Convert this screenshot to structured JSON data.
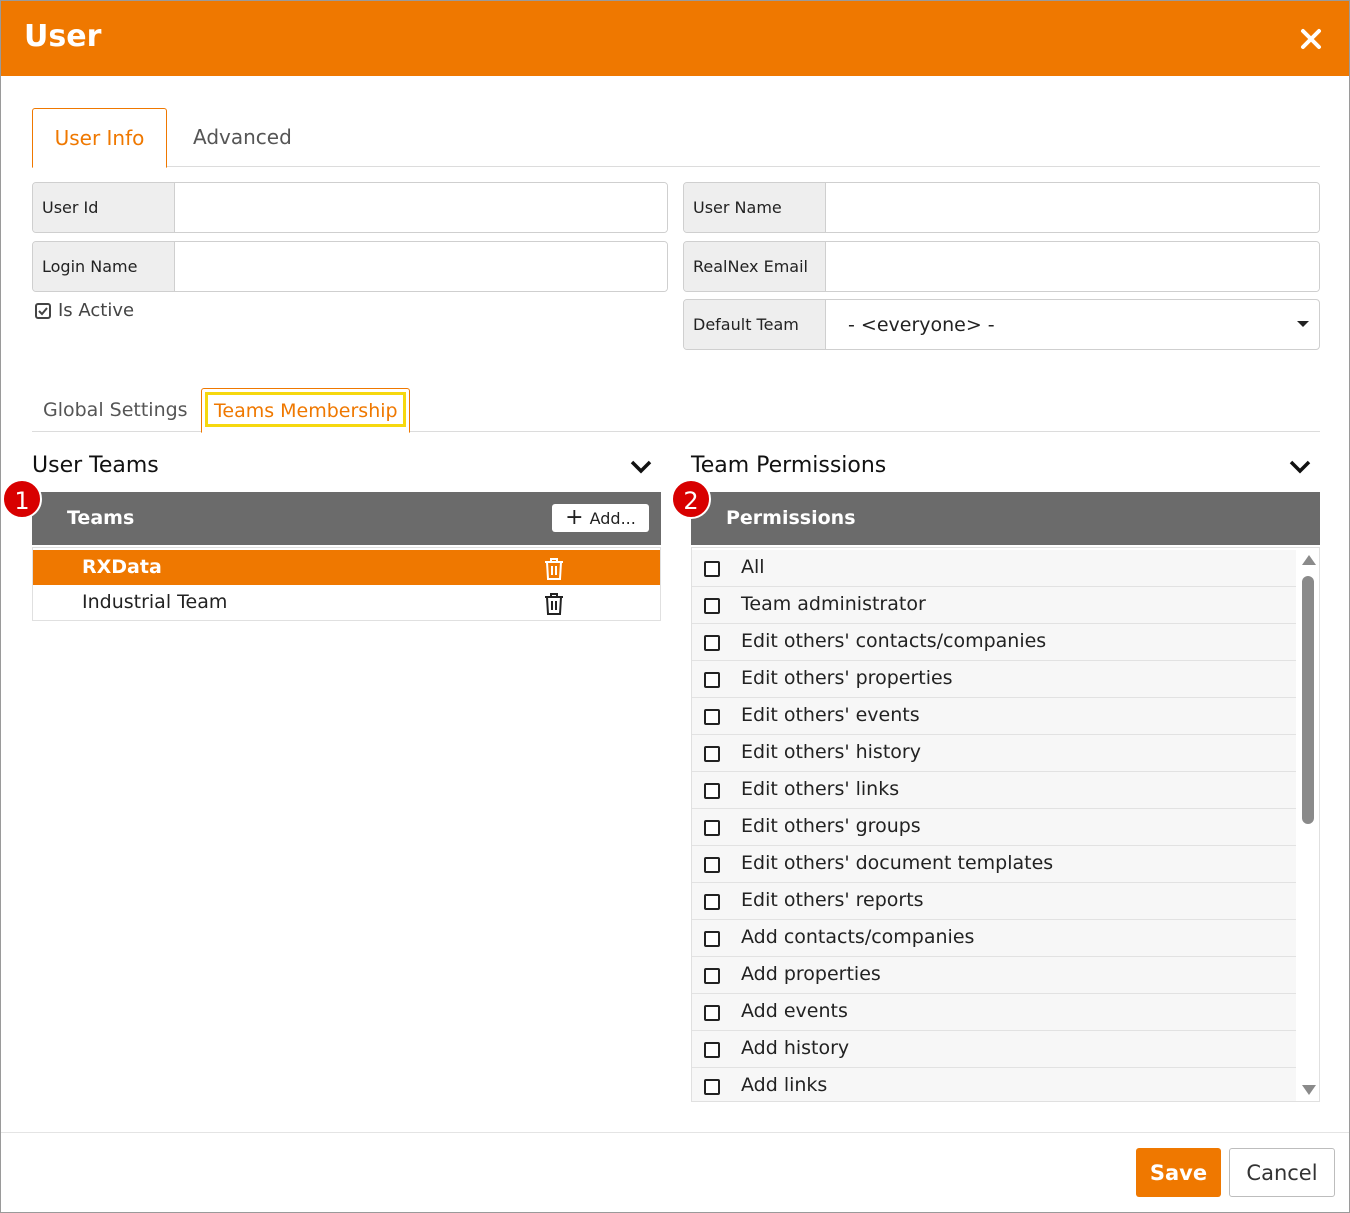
{
  "dialog": {
    "title": "User",
    "close_icon": "close-icon",
    "accent_color": "#ef7800"
  },
  "top_tabs": [
    {
      "label": "User Info",
      "active": true
    },
    {
      "label": "Advanced",
      "active": false
    }
  ],
  "fields": {
    "user_id": {
      "label": "User Id",
      "value": ""
    },
    "user_name": {
      "label": "User Name",
      "value": ""
    },
    "login_name": {
      "label": "Login Name",
      "value": ""
    },
    "realnex_email": {
      "label": "RealNex Email",
      "value": ""
    },
    "default_team": {
      "label": "Default Team",
      "value": "- <everyone> -"
    }
  },
  "is_active": {
    "label": "Is Active",
    "checked": true
  },
  "lower_tabs": [
    {
      "label": "Global Settings",
      "active": false
    },
    {
      "label": "Teams Membership",
      "active": true
    }
  ],
  "user_teams": {
    "title": "User Teams",
    "badge": "1",
    "column": "Teams",
    "add_label": "Add...",
    "rows": [
      {
        "name": "RXData",
        "selected": true
      },
      {
        "name": "Industrial Team",
        "selected": false
      }
    ]
  },
  "team_permissions": {
    "title": "Team Permissions",
    "badge": "2",
    "column": "Permissions",
    "rows": [
      {
        "label": "All",
        "checked": false
      },
      {
        "label": "Team administrator",
        "checked": false
      },
      {
        "label": "Edit others' contacts/companies",
        "checked": false
      },
      {
        "label": "Edit others' properties",
        "checked": false
      },
      {
        "label": "Edit others' events",
        "checked": false
      },
      {
        "label": "Edit others' history",
        "checked": false
      },
      {
        "label": "Edit others' links",
        "checked": false
      },
      {
        "label": "Edit others' groups",
        "checked": false
      },
      {
        "label": "Edit others' document templates",
        "checked": false
      },
      {
        "label": "Edit others' reports",
        "checked": false
      },
      {
        "label": "Add contacts/companies",
        "checked": false
      },
      {
        "label": "Add properties",
        "checked": false
      },
      {
        "label": "Add events",
        "checked": false
      },
      {
        "label": "Add history",
        "checked": false
      },
      {
        "label": "Add links",
        "checked": false
      }
    ]
  },
  "footer": {
    "save_label": "Save",
    "cancel_label": "Cancel"
  }
}
